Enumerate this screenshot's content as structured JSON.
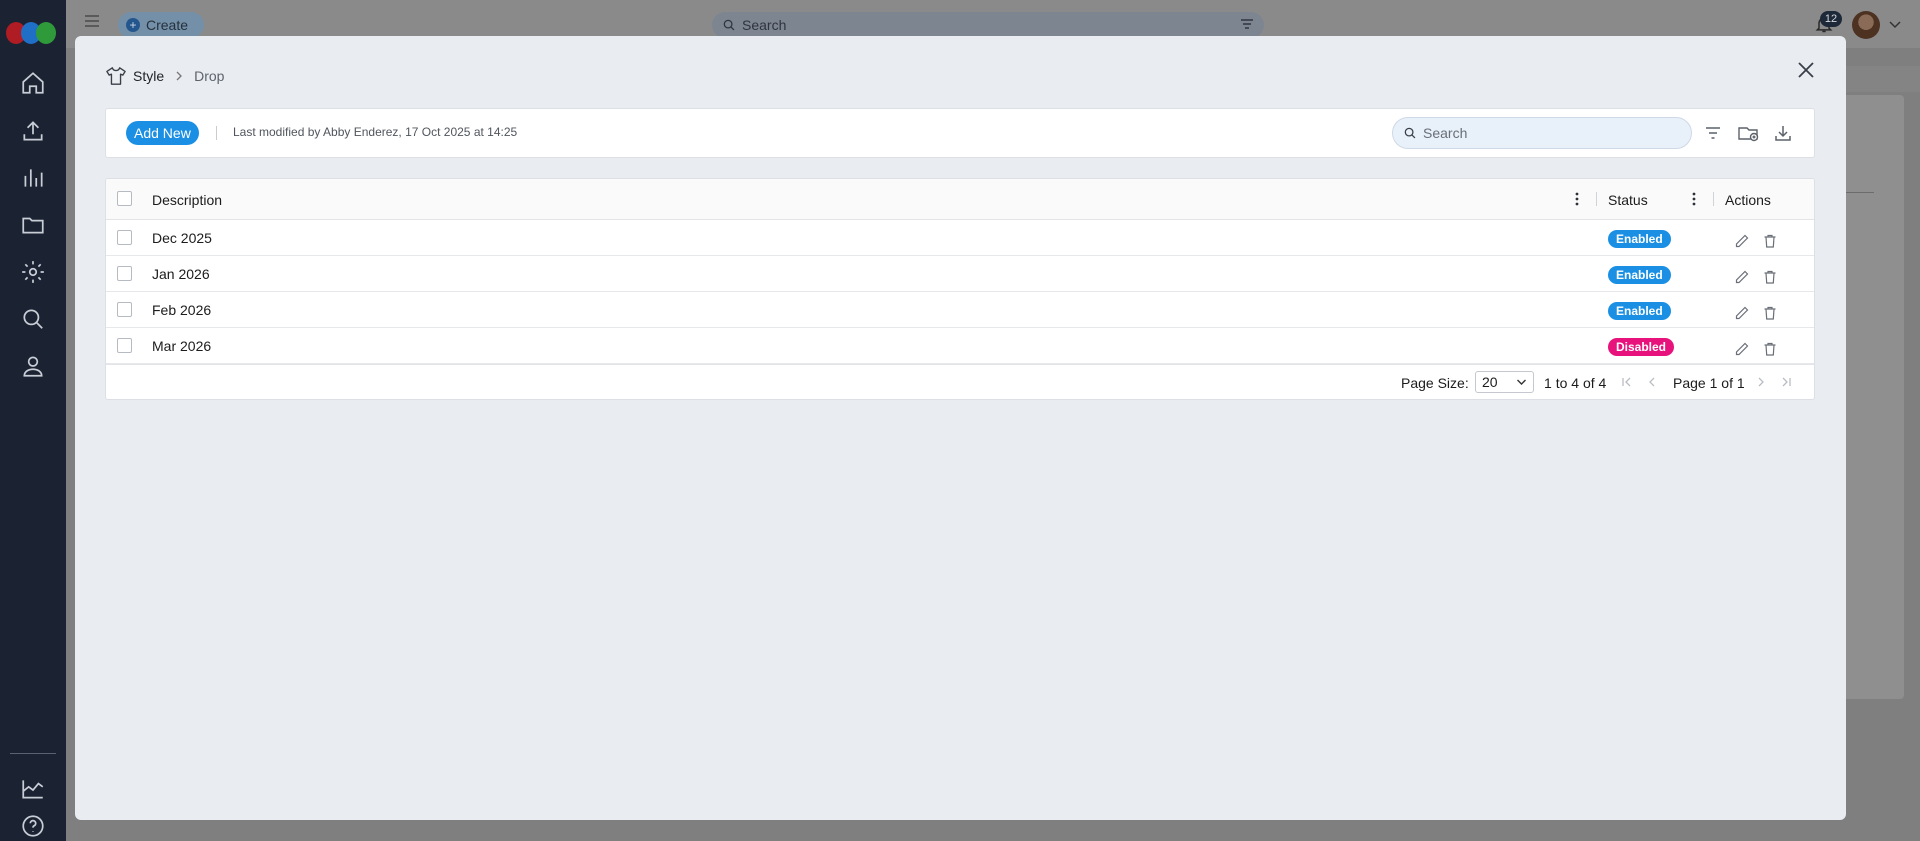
{
  "app": {
    "create_label": "Create",
    "global_search_placeholder": "Search",
    "notification_count": "12"
  },
  "modal": {
    "breadcrumb": {
      "parent": "Style",
      "current": "Drop"
    },
    "toolbar": {
      "add_new_label": "Add New",
      "last_modified": "Last modified by Abby Enderez, 17 Oct 2025 at 14:25",
      "search_placeholder": "Search"
    },
    "table": {
      "columns": [
        "Description",
        "Status",
        "Actions"
      ],
      "rows": [
        {
          "description": "Dec 2025",
          "status": "Enabled"
        },
        {
          "description": "Jan 2026",
          "status": "Enabled"
        },
        {
          "description": "Feb 2026",
          "status": "Enabled"
        },
        {
          "description": "Mar 2026",
          "status": "Disabled"
        }
      ]
    },
    "pagination": {
      "page_size_label": "Page Size:",
      "page_size_value": "20",
      "range_prefix": "1",
      "range_to_word": "to",
      "range_end": "4",
      "range_of_word": "of",
      "range_total": "4",
      "page_word": "Page",
      "page_current": "1",
      "page_of_word": "of",
      "page_total": "1"
    }
  },
  "colors": {
    "enabled": "#1a8fe3",
    "disabled": "#e8127c",
    "primary": "#1a8fe3"
  },
  "icons": [
    "home-icon",
    "upload-icon",
    "chart-icon",
    "folder-icon",
    "settings-icon",
    "search-icon",
    "user-icon",
    "analytics-icon",
    "help-icon",
    "shirt-icon",
    "close-icon",
    "filter-icon",
    "export-cloud-icon",
    "download-icon",
    "edit-icon",
    "delete-icon"
  ]
}
